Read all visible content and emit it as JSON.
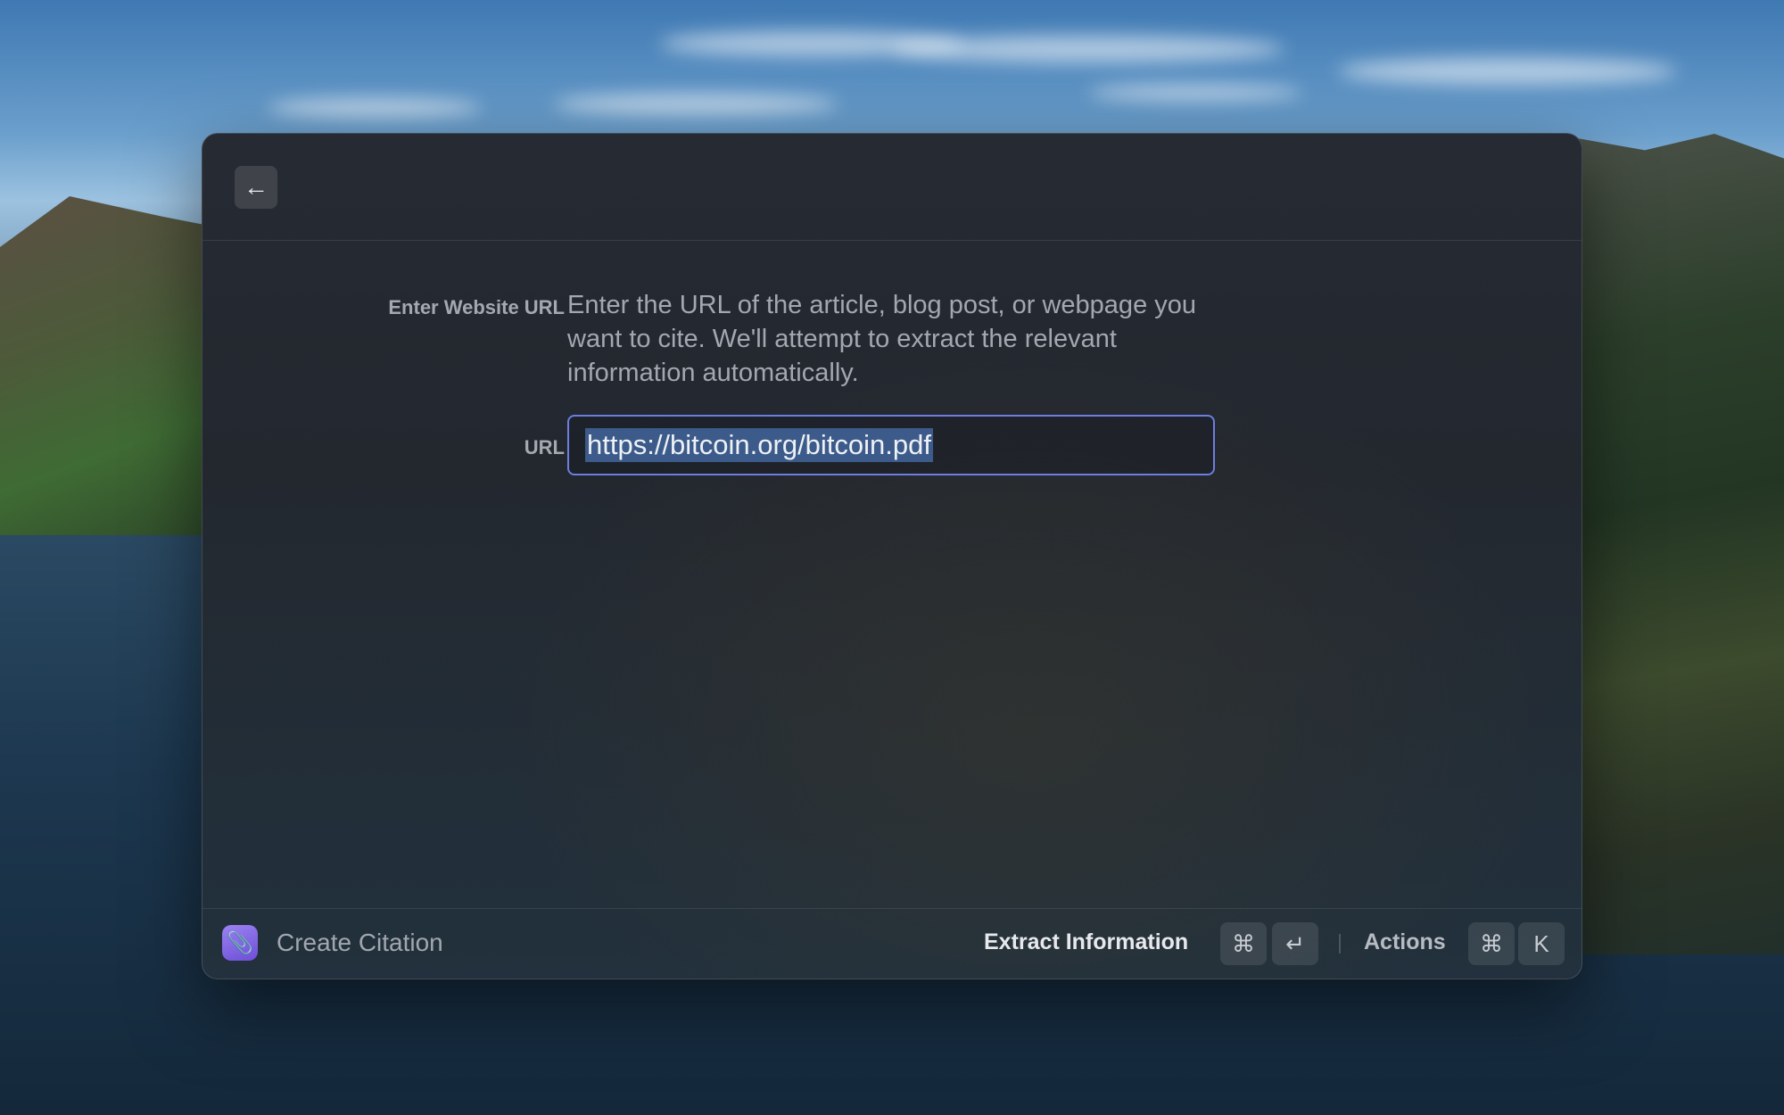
{
  "header": {
    "back_icon": "arrow-left-icon"
  },
  "form": {
    "website_label": "Enter Website URL",
    "description": "Enter the URL of the article, blog post, or webpage you want to cite. We'll attempt to extract the relevant information automatically.",
    "url_label": "URL",
    "url_value": "https://bitcoin.org/bitcoin.pdf",
    "accent_color": "#6d7ee0"
  },
  "footer": {
    "app_icon": "paperclip-icon",
    "title": "Create Citation",
    "primary_action": "Extract Information",
    "primary_shortcut": [
      "⌘",
      "↵"
    ],
    "secondary_action": "Actions",
    "secondary_shortcut": [
      "⌘",
      "K"
    ]
  }
}
